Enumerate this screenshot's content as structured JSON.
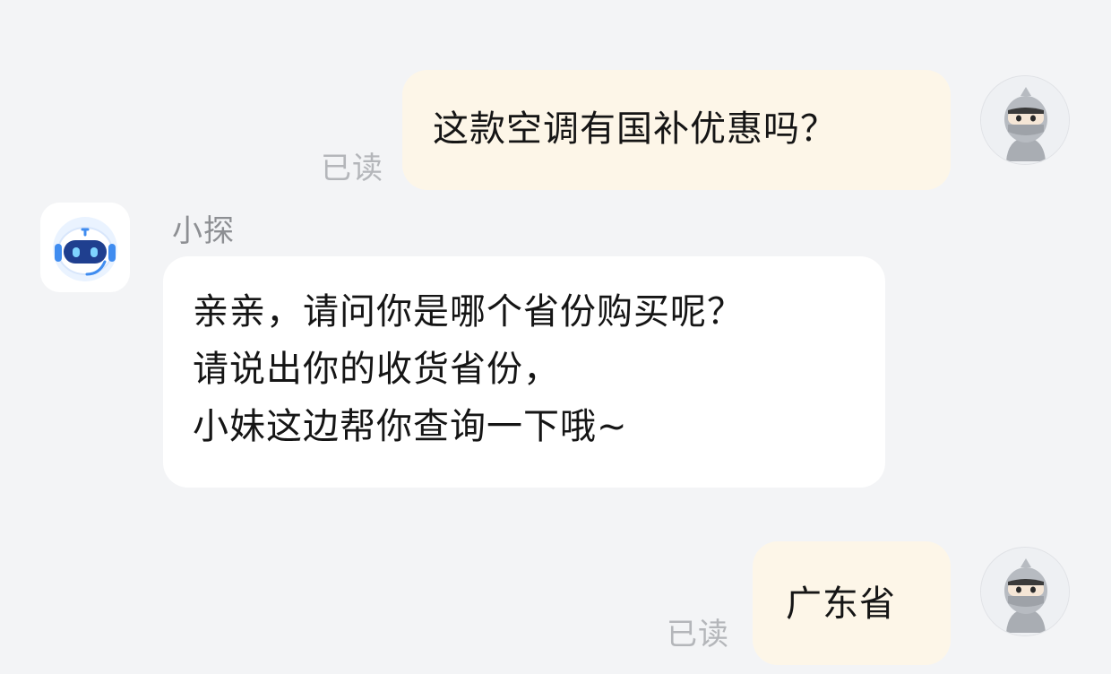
{
  "conversation": {
    "messages": [
      {
        "role": "user",
        "text": "这款空调有国补优惠吗？",
        "status": "已读"
      },
      {
        "role": "assistant",
        "sender": "小探",
        "lines": [
          "亲亲，请问你是哪个省份购买呢？",
          "请说出你的收货省份，",
          "小妹这边帮你查询一下哦~"
        ]
      },
      {
        "role": "user",
        "text": "广东省",
        "status": "已读"
      }
    ]
  },
  "colors": {
    "background": "#f3f4f6",
    "outgoing_bubble": "#fdf6e8",
    "incoming_bubble": "#ffffff",
    "bot_accent": "#3f8cf0"
  },
  "icons": {
    "user_avatar": "ninja-avatar-icon",
    "bot_avatar": "robot-avatar-icon"
  }
}
